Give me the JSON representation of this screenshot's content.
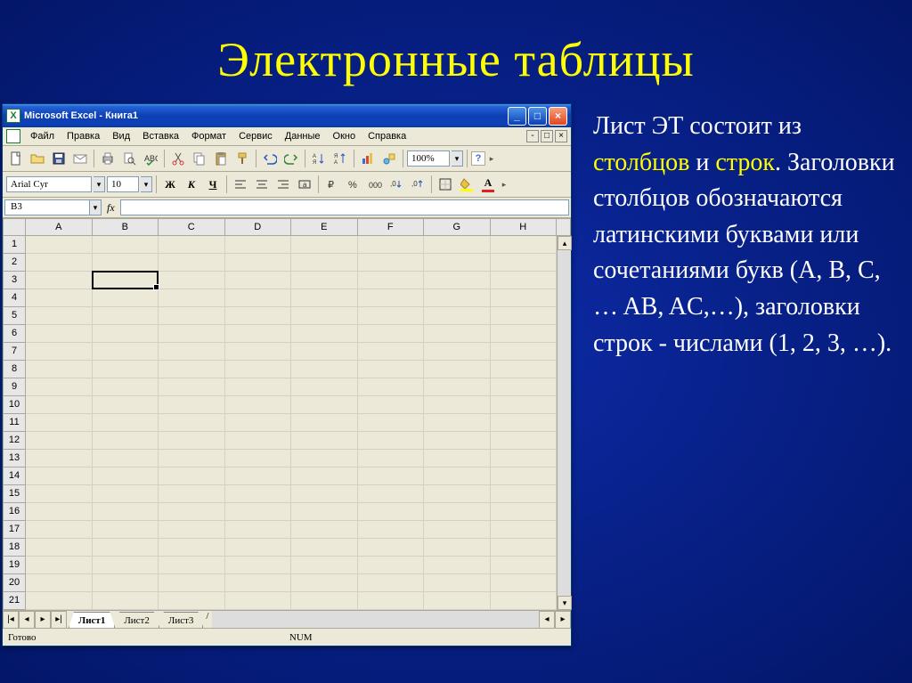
{
  "slide": {
    "title": "Электронные таблицы"
  },
  "window": {
    "title": "Microsoft Excel - Книга1"
  },
  "menu": {
    "items": [
      "Файл",
      "Правка",
      "Вид",
      "Вставка",
      "Формат",
      "Сервис",
      "Данные",
      "Окно",
      "Справка"
    ]
  },
  "toolbar": {
    "zoom": "100%"
  },
  "format": {
    "font": "Arial Cyr",
    "size": "10"
  },
  "namebox": "B3",
  "fx": "fx",
  "columns": [
    "A",
    "B",
    "C",
    "D",
    "E",
    "F",
    "G",
    "H"
  ],
  "rows": [
    "1",
    "2",
    "3",
    "4",
    "5",
    "6",
    "7",
    "8",
    "9",
    "10",
    "11",
    "12",
    "13",
    "14",
    "15",
    "16",
    "17",
    "18",
    "19",
    "20",
    "21"
  ],
  "selection": {
    "col": 1,
    "row": 2
  },
  "sheets": {
    "tabs": [
      "Лист1",
      "Лист2",
      "Лист3"
    ],
    "active": 0
  },
  "status": {
    "ready": "Готово",
    "num": "NUM"
  },
  "text": {
    "p1a": "Лист ЭТ состоит из ",
    "hl1": "столбцов",
    "p1b": " и ",
    "hl2": "строк",
    "p1c": ". Заголовки столбцов обозначаются латинскими буквами или сочетаниями букв (A, B, C, … AB, AC,…), заголовки строк  - числами (1, 2, 3, …)."
  }
}
